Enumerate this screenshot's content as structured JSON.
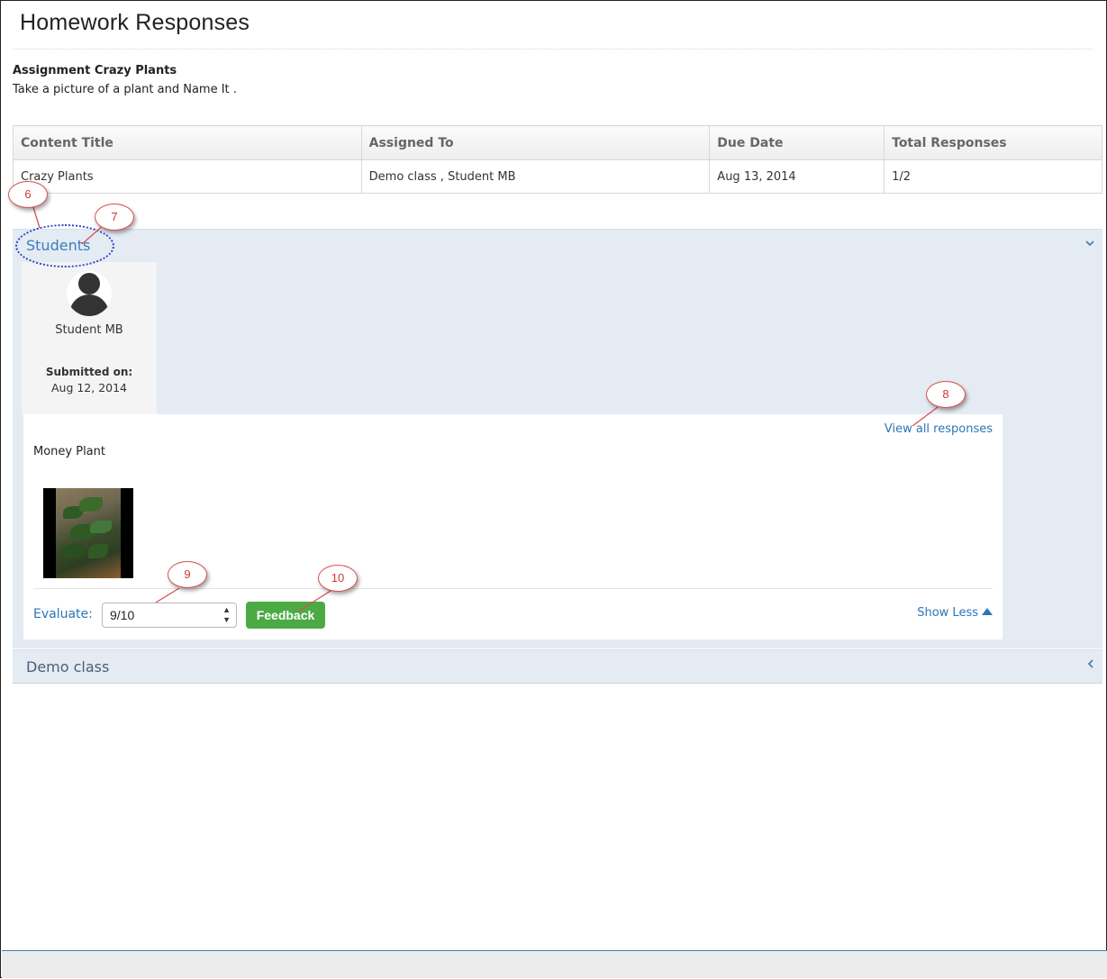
{
  "page": {
    "title": "Homework Responses"
  },
  "assignment": {
    "name": "Assignment Crazy Plants",
    "description": "Take a picture of a plant and Name It ."
  },
  "summary_table": {
    "headers": [
      "Content Title",
      "Assigned To",
      "Due Date",
      "Total Responses"
    ],
    "rows": [
      [
        "Crazy Plants",
        "Demo class , Student MB",
        "Aug 13, 2014",
        "1/2"
      ]
    ]
  },
  "students_panel": {
    "label": "Students",
    "chevron_icon": "chevron-down-icon",
    "student": {
      "name": "Student MB",
      "avatar_icon": "user-avatar-icon",
      "submitted_label": "Submitted on:",
      "submitted_date": "Aug 12, 2014"
    },
    "response": {
      "view_all_label": "View all responses",
      "text": "Money Plant",
      "image_alt": "plant photo thumbnail",
      "evaluate_label": "Evaluate:",
      "grade_value": "9/10",
      "feedback_label": "Feedback",
      "show_less_label": "Show Less",
      "show_less_icon": "triangle-up-icon"
    }
  },
  "demo_panel": {
    "label": "Demo class",
    "chevron_icon": "chevron-left-icon"
  },
  "callouts": [
    "6",
    "7",
    "8",
    "9",
    "10"
  ],
  "colors": {
    "link_blue": "#2a76b8",
    "panel_bg": "#e4ebf2",
    "feedback_green": "#4caa45",
    "callout_red": "#d43535",
    "highlight_blue": "#2a45c9"
  }
}
